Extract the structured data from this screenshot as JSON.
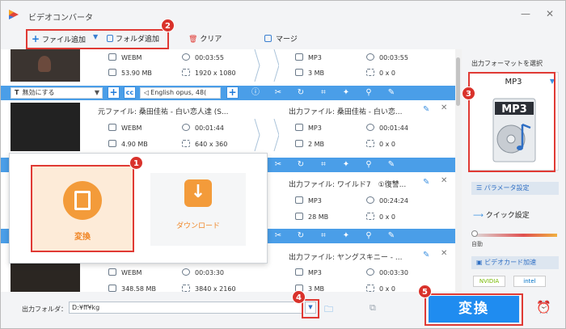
{
  "app": {
    "title": "ビデオコンバータ"
  },
  "toolbar": {
    "add_file": "ファイル追加",
    "add_folder": "フォルダ追加",
    "clear": "クリア",
    "merge": "マージ"
  },
  "files": [
    {
      "src_format": "WEBM",
      "src_duration": "00:03:55",
      "src_size": "53.90 MB",
      "src_resolution": "1920 x 1080",
      "out_format": "MP3",
      "out_duration": "00:03:55",
      "out_size": "3 MB",
      "out_resolution": "0 x 0"
    },
    {
      "src_name": "元ファイル: 桑田佳祐 - 白い恋人達 (S...",
      "out_name": "出力ファイル: 桑田佳祐 - 白い恋...",
      "src_format": "WEBM",
      "src_duration": "00:01:44",
      "src_size": "4.90 MB",
      "src_resolution": "640 x 360",
      "out_format": "MP3",
      "out_duration": "00:01:44",
      "out_size": "2 MB",
      "out_resolution": "0 x 0"
    },
    {
      "out_name": "出力ファイル: ワイルド7　①復讐...",
      "out_format": "MP3",
      "out_duration": "00:24:24",
      "out_size": "28 MB",
      "out_resolution": "0 x 0"
    },
    {
      "out_name": "出力ファイル: ヤングスキニー - ...",
      "src_format": "WEBM",
      "src_duration": "00:03:30",
      "src_size": "348.58 MB",
      "src_resolution": "3840 x 2160",
      "out_format": "MP3",
      "out_duration": "00:03:30",
      "out_size": "3 MB",
      "out_resolution": "0 x 0"
    }
  ],
  "actionbar": {
    "subtitle": "無効にする",
    "audio": "English opus, 48("
  },
  "popup": {
    "convert": "変換",
    "download": "ダウンロード"
  },
  "right": {
    "format_heading": "出力フォーマットを選択",
    "format": "MP3",
    "params": "パラメータ設定",
    "quick": "クイック設定",
    "auto": "自動",
    "accel": "ビデオカード加速",
    "nvidia": "NVIDIA",
    "intel": "intel"
  },
  "bottom": {
    "folder_label": "出力フォルダ：",
    "folder_path": "D:¥ff¥kg",
    "convert_button": "変換"
  },
  "badges": [
    "1",
    "2",
    "3",
    "4",
    "5"
  ],
  "colors": {
    "accent": "#1f8cf0",
    "highlight": "#e03a34",
    "orange": "#f39b3a"
  }
}
